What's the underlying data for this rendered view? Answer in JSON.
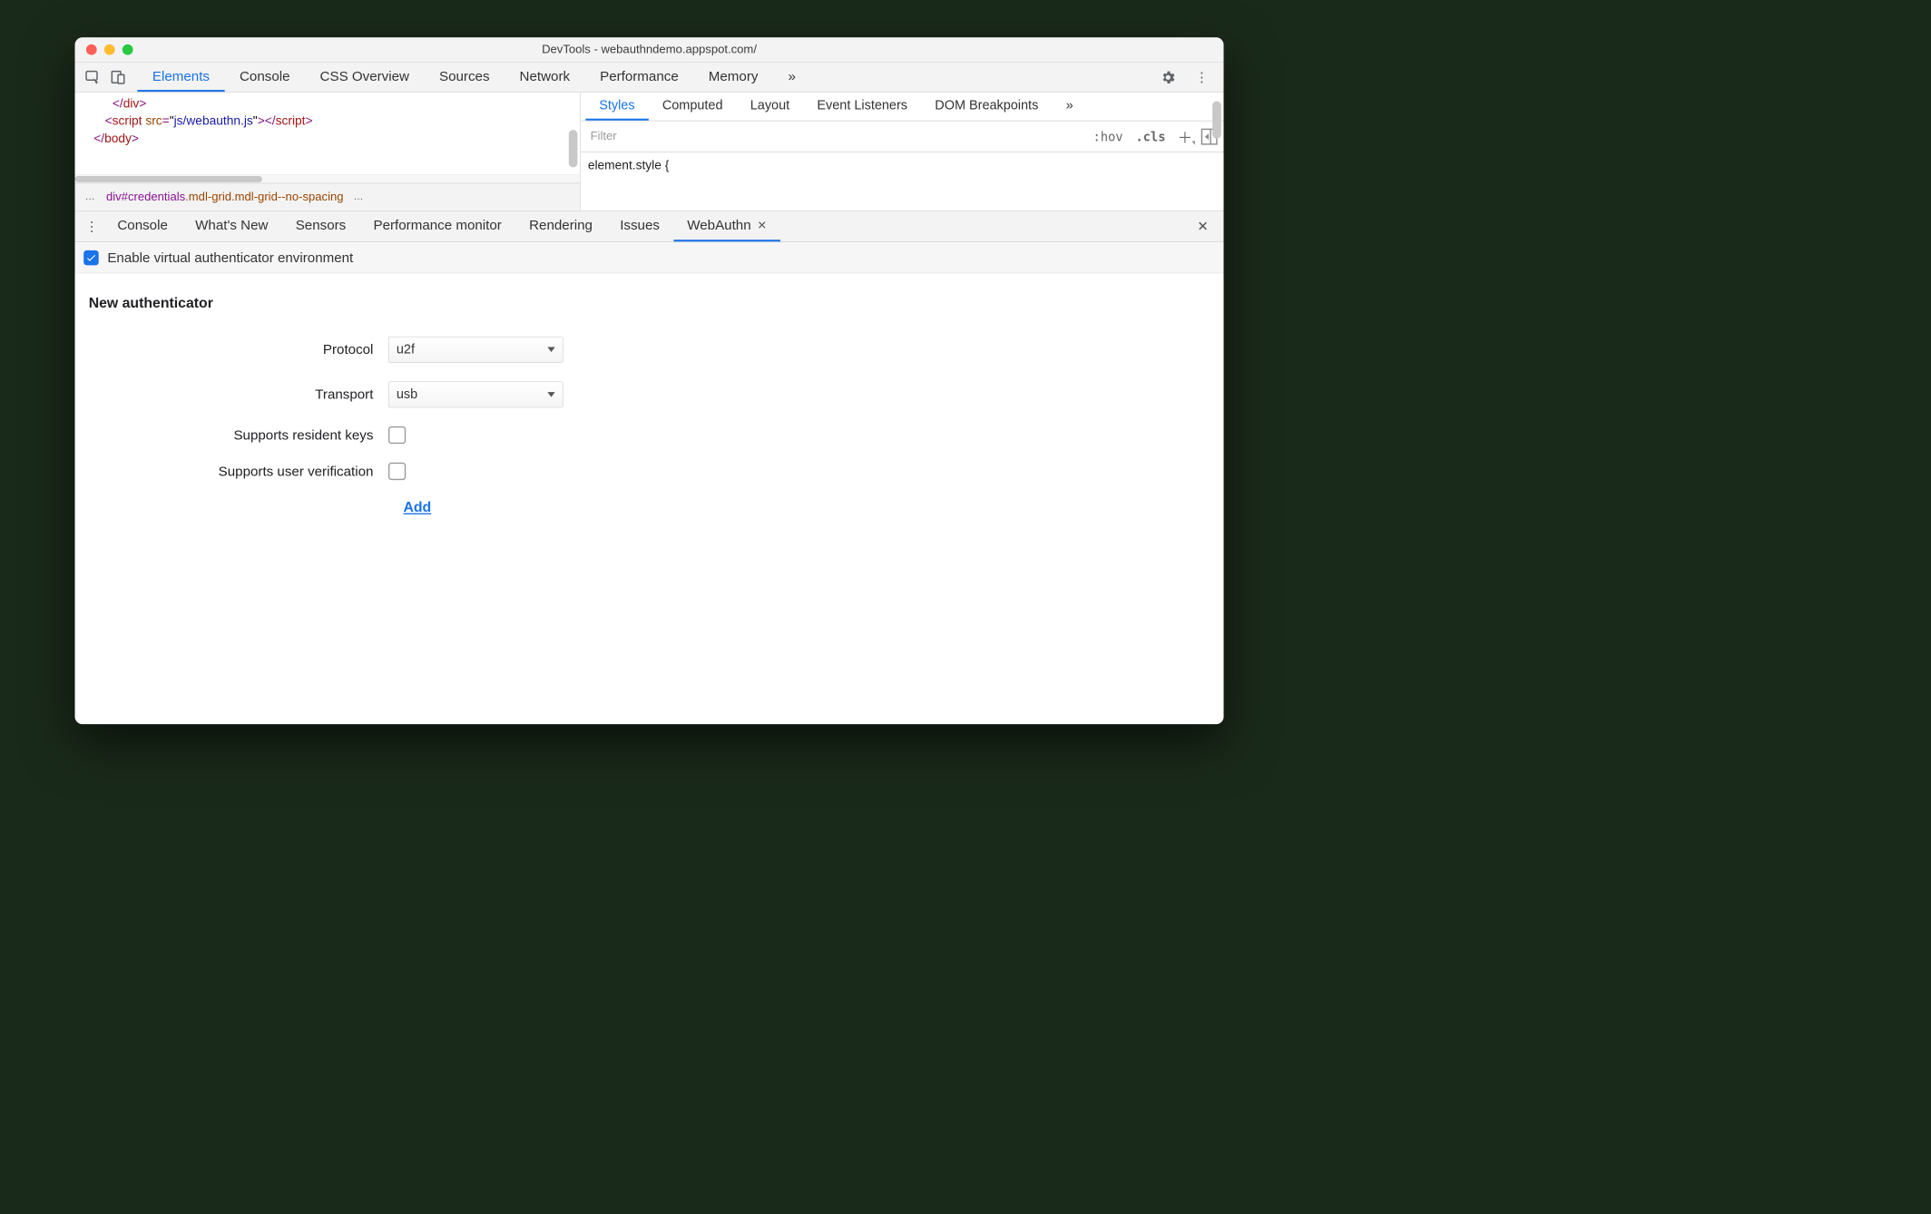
{
  "window": {
    "title": "DevTools - webauthndemo.appspot.com/"
  },
  "mainTabs": {
    "items": [
      "Elements",
      "Console",
      "CSS Overview",
      "Sources",
      "Network",
      "Performance",
      "Memory"
    ],
    "overflow": "»",
    "activeIndex": 0
  },
  "code": {
    "line1_close": "</div>",
    "line2_open": "<script ",
    "line2_attr": "src",
    "line2_eq": "=\"",
    "line2_val": "js/webauthn.js",
    "line2_endq": "\">",
    "line2_close": "</script",
    "line3_close": "</body>"
  },
  "breadcrumb": {
    "tag": "div",
    "id": "#credentials",
    "classes": ".mdl-grid.mdl-grid--no-spacing",
    "ell": "…"
  },
  "styles": {
    "tabs": [
      "Styles",
      "Computed",
      "Layout",
      "Event Listeners",
      "DOM Breakpoints"
    ],
    "overflow": "»",
    "activeIndex": 0,
    "filterPlaceholder": "Filter",
    "hov": ":hov",
    "cls": ".cls",
    "bodyText": "element.style {"
  },
  "drawer": {
    "tabs": [
      "Console",
      "What's New",
      "Sensors",
      "Performance monitor",
      "Rendering",
      "Issues",
      "WebAuthn"
    ],
    "activeIndex": 6
  },
  "webauthn": {
    "enableLabel": "Enable virtual authenticator environment",
    "enableChecked": true,
    "formTitle": "New authenticator",
    "rows": {
      "protocol": {
        "label": "Protocol",
        "value": "u2f"
      },
      "transport": {
        "label": "Transport",
        "value": "usb"
      },
      "residentKeys": {
        "label": "Supports resident keys",
        "checked": false
      },
      "userVerification": {
        "label": "Supports user verification",
        "checked": false
      }
    },
    "addLabel": "Add"
  }
}
